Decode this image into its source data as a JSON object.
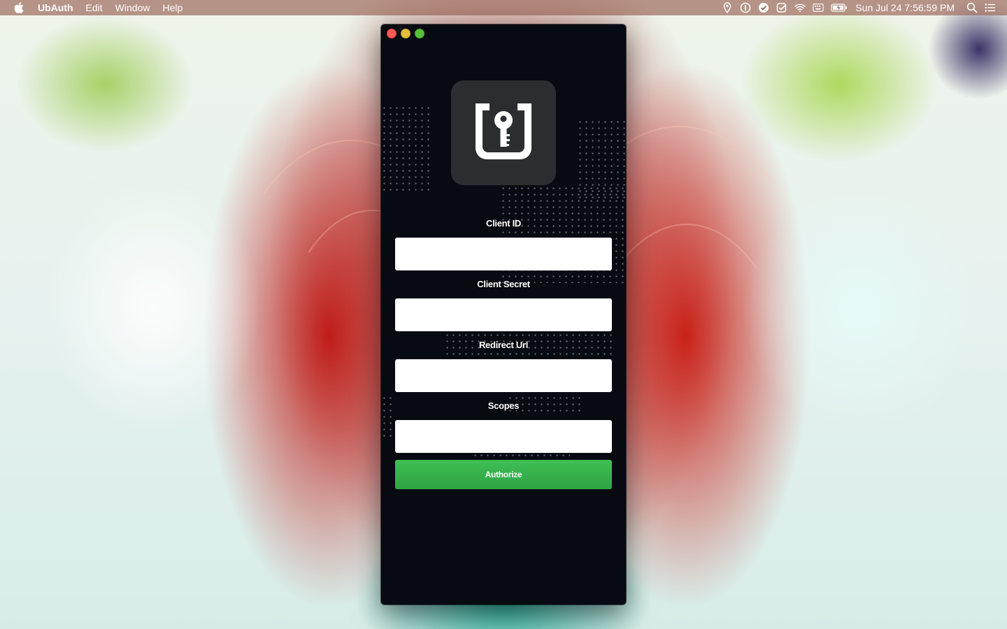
{
  "menubar": {
    "app_name": "UbAuth",
    "menus": [
      "Edit",
      "Window",
      "Help"
    ],
    "clock": "Sun Jul 24  7:56:59 PM",
    "status_icons": [
      "location-icon",
      "1password-icon",
      "checkmark-circle-icon",
      "checkbox-icon",
      "wifi-icon",
      "keyboard-icon",
      "battery-icon",
      "spotlight-icon",
      "notification-center-icon"
    ]
  },
  "window": {
    "logo_icon": "ubauth-key-icon",
    "fields": [
      {
        "label": "Client ID",
        "value": "",
        "placeholder": ""
      },
      {
        "label": "Client Secret",
        "value": "",
        "placeholder": ""
      },
      {
        "label": "Redirect Url",
        "value": "",
        "placeholder": ""
      },
      {
        "label": "Scopes",
        "value": "",
        "placeholder": ""
      }
    ],
    "authorize_label": "Authorize"
  },
  "colors": {
    "window_bg": "#080a12",
    "button_green": "#35b04b",
    "logo_bg": "#2c2d31"
  }
}
